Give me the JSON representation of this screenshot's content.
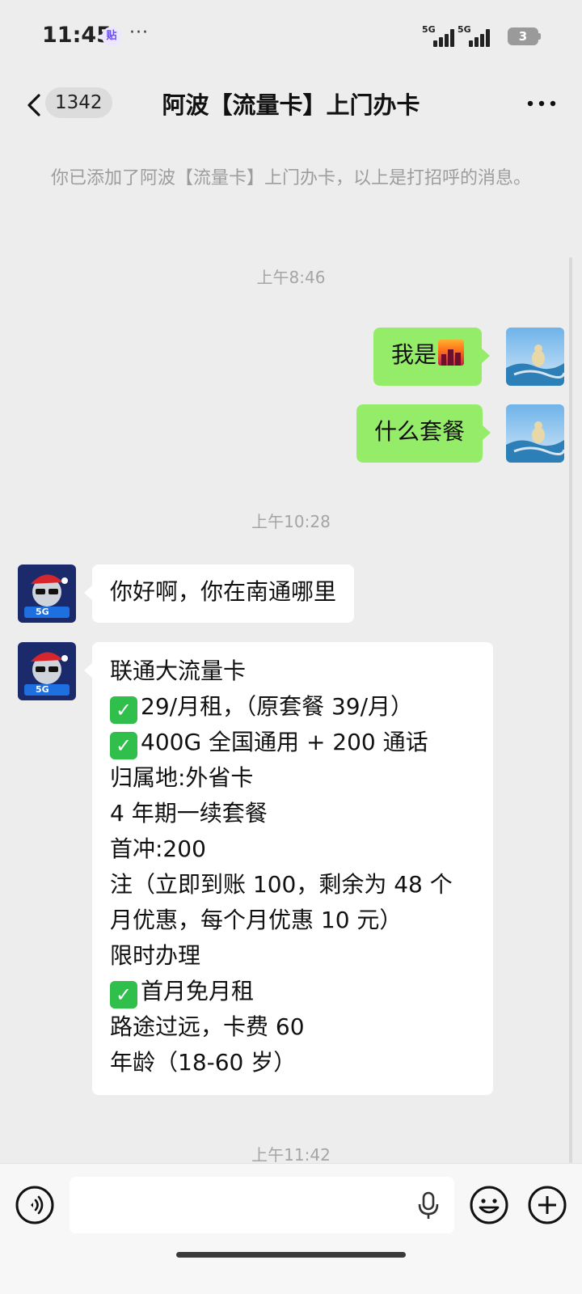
{
  "status_bar": {
    "time": "11:45",
    "app_icon_text": "贴",
    "more": "···",
    "signal_1": "5G",
    "signal_2": "5G",
    "battery": "3"
  },
  "header": {
    "back_label": "‹",
    "unread_count": "1342",
    "title": "阿波【流量卡】上门办卡",
    "more_icon": "more-dots-icon"
  },
  "system_message": "你已添加了阿波【流量卡】上门办卡，以上是打招呼的消息。",
  "messages": [
    {
      "type": "timestamp",
      "text": "上午8:46"
    },
    {
      "type": "me",
      "text": "我是",
      "emoji": "city-sunset-emoji"
    },
    {
      "type": "me",
      "text": "什么套餐"
    },
    {
      "type": "timestamp",
      "text": "上午10:28"
    },
    {
      "type": "them",
      "text": "你好啊，你在南通哪里"
    },
    {
      "type": "them",
      "lines": [
        {
          "check": false,
          "text": "联通大流量卡"
        },
        {
          "check": true,
          "text": "29/月租，（原套餐 39/月）"
        },
        {
          "check": true,
          "text": "400G 全国通用 + 200 通话"
        },
        {
          "check": false,
          "text": "归属地:外省卡"
        },
        {
          "check": false,
          "text": "4 年期一续套餐"
        },
        {
          "check": false,
          "text": "首冲:200"
        },
        {
          "check": false,
          "text": "注（立即到账 100，剩余为 48 个"
        },
        {
          "check": false,
          "text": "月优惠，每个月优惠 10 元）"
        },
        {
          "check": false,
          "text": "限时办理"
        },
        {
          "check": true,
          "text": "首月免月租"
        },
        {
          "check": false,
          "text": "路途过远，卡费 60"
        },
        {
          "check": false,
          "text": "年龄（18-60 岁）"
        }
      ]
    },
    {
      "type": "timestamp",
      "text": "上午11:42"
    }
  ],
  "contact_avatar_text": "5G",
  "input_bar": {
    "placeholder": "",
    "voice_icon": "voice-mode-icon",
    "mic_icon": "microphone-icon",
    "emoji_icon": "emoji-icon",
    "plus_icon": "plus-icon"
  },
  "colors": {
    "background": "#ededed",
    "my_bubble": "#95ec69",
    "their_bubble": "#ffffff",
    "check_green": "#2fbf4a"
  }
}
